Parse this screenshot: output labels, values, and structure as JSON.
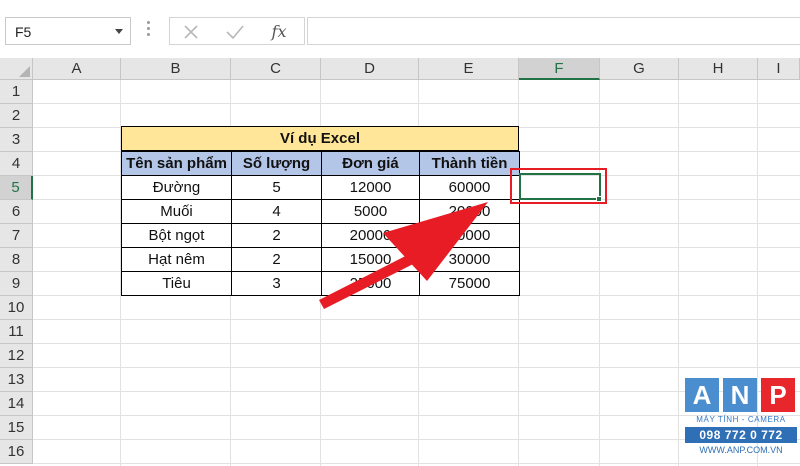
{
  "formula_bar": {
    "name_box": "F5",
    "fx_label": "fx",
    "formula": ""
  },
  "columns": [
    "A",
    "B",
    "C",
    "D",
    "E",
    "F",
    "G",
    "H",
    "I"
  ],
  "rows": [
    "1",
    "2",
    "3",
    "4",
    "5",
    "6",
    "7",
    "8",
    "9",
    "10",
    "11",
    "12",
    "13",
    "14",
    "15",
    "16"
  ],
  "selection": {
    "cell": "F5",
    "column": "F",
    "row": "5"
  },
  "table": {
    "title": "Ví dụ Excel",
    "headers": [
      "Tên sản phẩm",
      "Số lượng",
      "Đơn giá",
      "Thành tiền"
    ],
    "rows": [
      [
        "Đường",
        "5",
        "12000",
        "60000"
      ],
      [
        "Muối",
        "4",
        "5000",
        "20000"
      ],
      [
        "Bột ngọt",
        "2",
        "20000",
        "40000"
      ],
      [
        "Hạt nêm",
        "2",
        "15000",
        "30000"
      ],
      [
        "Tiêu",
        "3",
        "25000",
        "75000"
      ]
    ]
  },
  "colors": {
    "title_fill": "#ffe699",
    "header_fill": "#b4c6e7",
    "selection_accent": "#217346",
    "highlight": "#e81c24",
    "arrow": "#e81c24"
  },
  "watermark": {
    "letters": [
      "A",
      "N",
      "P"
    ],
    "tagline": "MÁY TÍNH - CAMERA",
    "phone": "098 772 0 772",
    "url": "WWW.ANP.COM.VN"
  }
}
